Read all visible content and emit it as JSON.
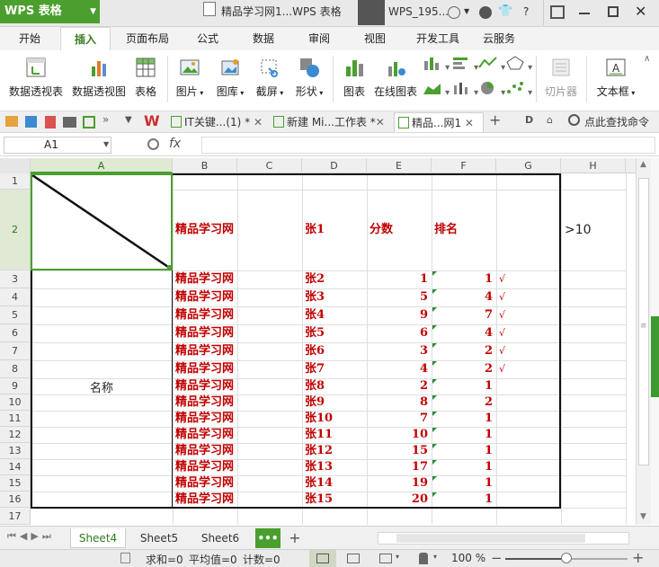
{
  "titlebar": {
    "app_name": "WPS 表格",
    "doc_title": "精品学习网1...WPS 表格",
    "user_name": "WPS_195...",
    "help_label": "?"
  },
  "menus": [
    "开始",
    "插入",
    "页面布局",
    "公式",
    "数据",
    "审阅",
    "视图",
    "开发工具",
    "云服务"
  ],
  "active_menu": "插入",
  "ribbon": {
    "pivot_table": "数据透视表",
    "pivot_chart": "数据透视图",
    "table": "表格",
    "picture": "图片",
    "gallery": "图库",
    "screenshot": "截屏",
    "shape": "形状",
    "chart": "图表",
    "online_chart": "在线图表",
    "slicer": "切片器",
    "textbox": "文本框"
  },
  "doc_tabs": [
    {
      "label": "IT关键...(1) *"
    },
    {
      "label": "新建 Mi...工作表 *"
    },
    {
      "label": "精品...网1"
    }
  ],
  "search_command": "点此查找命令",
  "formula_bar": {
    "name_box": "A1",
    "fx": "fx",
    "value": ""
  },
  "columns": [
    "A",
    "B",
    "C",
    "D",
    "E",
    "F",
    "G",
    "H"
  ],
  "row_numbers": [
    "1",
    "2",
    "3",
    "4",
    "5",
    "6",
    "7",
    "8",
    "9",
    "10",
    "11",
    "12",
    "13",
    "14",
    "15",
    "16",
    "17"
  ],
  "header_row": {
    "b": "精品学习网",
    "d": "张1",
    "e": "分数",
    "f": "排名",
    "h": ">10"
  },
  "merged_label": "名称",
  "rows": [
    {
      "b": "精品学习网",
      "d": "张2",
      "e": "1",
      "f": "1",
      "g": "√"
    },
    {
      "b": "精品学习网",
      "d": "张3",
      "e": "5",
      "f": "4",
      "g": "√"
    },
    {
      "b": "精品学习网",
      "d": "张4",
      "e": "9",
      "f": "7",
      "g": "√"
    },
    {
      "b": "精品学习网",
      "d": "张5",
      "e": "6",
      "f": "4",
      "g": "√"
    },
    {
      "b": "精品学习网",
      "d": "张6",
      "e": "3",
      "f": "2",
      "g": "√"
    },
    {
      "b": "精品学习网",
      "d": "张7",
      "e": "4",
      "f": "2",
      "g": "√"
    },
    {
      "b": "精品学习网",
      "d": "张8",
      "e": "2",
      "f": "1",
      "g": ""
    },
    {
      "b": "精品学习网",
      "d": "张9",
      "e": "8",
      "f": "2",
      "g": ""
    },
    {
      "b": "精品学习网",
      "d": "张10",
      "e": "7",
      "f": "1",
      "g": ""
    },
    {
      "b": "精品学习网",
      "d": "张11",
      "e": "10",
      "f": "1",
      "g": ""
    },
    {
      "b": "精品学习网",
      "d": "张12",
      "e": "15",
      "f": "1",
      "g": ""
    },
    {
      "b": "精品学习网",
      "d": "张13",
      "e": "17",
      "f": "1",
      "g": ""
    },
    {
      "b": "精品学习网",
      "d": "张14",
      "e": "19",
      "f": "1",
      "g": ""
    },
    {
      "b": "精品学习网",
      "d": "张15",
      "e": "20",
      "f": "1",
      "g": ""
    }
  ],
  "sheets": [
    "Sheet4",
    "Sheet5",
    "Sheet6"
  ],
  "active_sheet": "Sheet4",
  "more_sheets": "•••",
  "add_sheet": "+",
  "status": {
    "sum": "求和=0",
    "avg": "平均值=0",
    "count": "计数=0",
    "zoom": "100 %",
    "zoom_fraction": 0.5
  },
  "colors": {
    "accent": "#4a9f2e",
    "cell_text": "#c00000",
    "error_triangle": "#2e8b3a"
  }
}
